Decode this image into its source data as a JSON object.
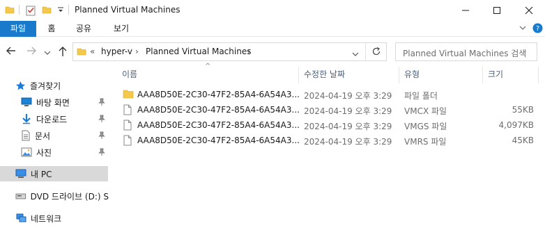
{
  "window": {
    "title": "Planned Virtual Machines",
    "minimize_icon": "minimize-icon",
    "maximize_icon": "maximize-icon",
    "close_icon": "close-icon"
  },
  "quick_access": [
    "folder-icon",
    "properties-check-icon",
    "new-folder-icon",
    "customize-dropdown-icon"
  ],
  "ribbon": {
    "tabs": [
      "파일",
      "홈",
      "공유",
      "보기"
    ],
    "active_tab": "파일"
  },
  "address": {
    "overflow": "«",
    "crumbs": [
      "hyper-v",
      "Planned Virtual Machines"
    ]
  },
  "search": {
    "placeholder": "Planned Virtual Machines 검색"
  },
  "nav": {
    "quick_access_label": "즐겨찾기",
    "items": [
      {
        "label": "바탕 화면",
        "pinned": true
      },
      {
        "label": "다운로드",
        "pinned": true
      },
      {
        "label": "문서",
        "pinned": true
      },
      {
        "label": "사진",
        "pinned": true
      }
    ],
    "this_pc": "내 PC",
    "dvd": "DVD 드라이브 (D:) S",
    "network": "네트워크"
  },
  "columns": {
    "name": "이름",
    "date": "수정한 날짜",
    "type": "유형",
    "size": "크기"
  },
  "files": [
    {
      "name": "AAA8D50E-2C30-47F2-85A4-6A54A3...",
      "date": "2024-04-19 오후 3:29",
      "type": "파일 폴더",
      "size": "",
      "icon": "folder-icon"
    },
    {
      "name": "AAA8D50E-2C30-47F2-85A4-6A54A3...",
      "date": "2024-04-19 오후 3:29",
      "type": "VMCX 파일",
      "size": "55KB",
      "icon": "file-icon"
    },
    {
      "name": "AAA8D50E-2C30-47F2-85A4-6A54A3...",
      "date": "2024-04-19 오후 3:29",
      "type": "VMGS 파일",
      "size": "4,097KB",
      "icon": "file-icon"
    },
    {
      "name": "AAA8D50E-2C30-47F2-85A4-6A54A3...",
      "date": "2024-04-19 오후 3:29",
      "type": "VMRS 파일",
      "size": "45KB",
      "icon": "file-icon"
    }
  ],
  "colors": {
    "accent": "#1979ca",
    "folder": "#f3c84d",
    "selection": "#d9d9d9"
  }
}
